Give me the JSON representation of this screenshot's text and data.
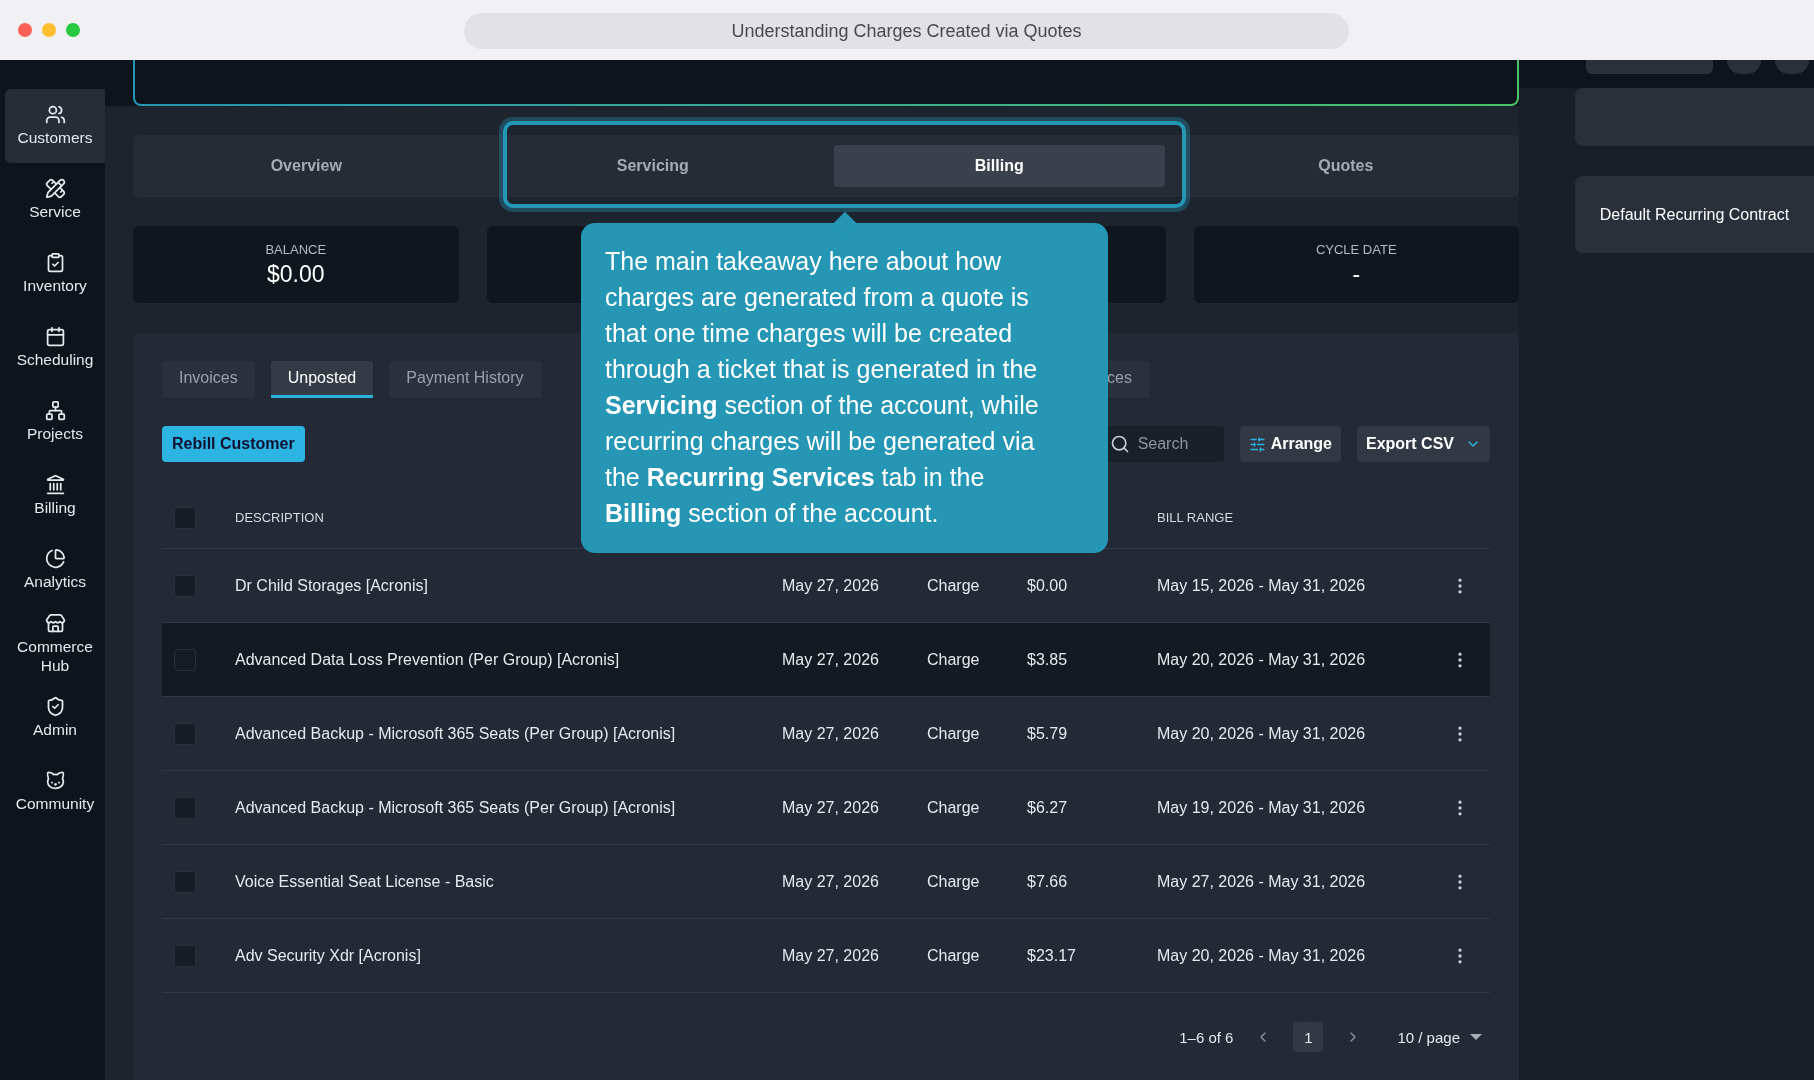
{
  "window": {
    "title": "Understanding Charges Created via Quotes"
  },
  "sidebar": {
    "items": [
      {
        "label": "Customers",
        "selected": true
      },
      {
        "label": "Service",
        "selected": false
      },
      {
        "label": "Inventory",
        "selected": false
      },
      {
        "label": "Scheduling",
        "selected": false
      },
      {
        "label": "Projects",
        "selected": false
      },
      {
        "label": "Billing",
        "selected": false
      },
      {
        "label": "Analytics",
        "selected": false
      },
      {
        "label": "Commerce Hub",
        "selected": false
      },
      {
        "label": "Admin",
        "selected": false
      },
      {
        "label": "Community",
        "selected": false
      }
    ]
  },
  "tabs": [
    {
      "label": "Overview",
      "selected": false
    },
    {
      "label": "Servicing",
      "selected": false
    },
    {
      "label": "Billing",
      "selected": true
    },
    {
      "label": "Quotes",
      "selected": false
    }
  ],
  "stats": [
    {
      "label": "BALANCE",
      "value": "$0.00"
    },
    {
      "label": "CYCLE DATE",
      "value": "-"
    }
  ],
  "subtabs": [
    {
      "label": "Invoices",
      "selected": false
    },
    {
      "label": "Unposted",
      "selected": true
    },
    {
      "label": "Payment History",
      "selected": false
    },
    {
      "label": "ces",
      "selected": false
    }
  ],
  "toolbar": {
    "rebill_button": "Rebill Customer",
    "search": {
      "placeholder": "Search"
    },
    "arrange_button": "Arrange",
    "export_button": "Export CSV"
  },
  "table": {
    "header": {
      "checked": false,
      "description": "DESCRIPTION",
      "bill_range": "BILL RANGE"
    },
    "rows": [
      {
        "checked": false,
        "selected": false,
        "description": "Dr Child Storages [Acronis]",
        "date": "May 27, 2026",
        "type": "Charge",
        "amount": "$0.00",
        "bill_range": "May 15, 2026 - May 31, 2026"
      },
      {
        "checked": false,
        "selected": true,
        "description": "Advanced Data Loss Prevention (Per Group) [Acronis]",
        "date": "May 27, 2026",
        "type": "Charge",
        "amount": "$3.85",
        "bill_range": "May 20, 2026 - May 31, 2026"
      },
      {
        "checked": false,
        "selected": false,
        "description": "Advanced Backup - Microsoft 365 Seats (Per Group) [Acronis]",
        "date": "May 27, 2026",
        "type": "Charge",
        "amount": "$5.79",
        "bill_range": "May 20, 2026 - May 31, 2026"
      },
      {
        "checked": false,
        "selected": false,
        "description": "Advanced Backup - Microsoft 365 Seats (Per Group) [Acronis]",
        "date": "May 27, 2026",
        "type": "Charge",
        "amount": "$6.27",
        "bill_range": "May 19, 2026 - May 31, 2026"
      },
      {
        "checked": false,
        "selected": false,
        "description": "Voice Essential Seat License - Basic",
        "date": "May 27, 2026",
        "type": "Charge",
        "amount": "$7.66",
        "bill_range": "May 27, 2026 - May 31, 2026"
      },
      {
        "checked": false,
        "selected": false,
        "description": "Adv Security Xdr [Acronis]",
        "date": "May 27, 2026",
        "type": "Charge",
        "amount": "$23.17",
        "bill_range": "May 20, 2026 - May 31, 2026"
      }
    ]
  },
  "pagination": {
    "range": "1–6 of 6",
    "pages": [
      {
        "label": "1",
        "selected": true
      }
    ],
    "page_size": "10 / page"
  },
  "right_panel": {
    "card_label": "Default Recurring Contract"
  },
  "tooltip": {
    "text": "The main takeaway here about how charges are generated from a quote is that one time charges will be created through a ticket that is generated in the **Servicing** section of the account, while recurring charges will be generated via the **Recurring Services** tab in the **Billing** section of the account."
  }
}
